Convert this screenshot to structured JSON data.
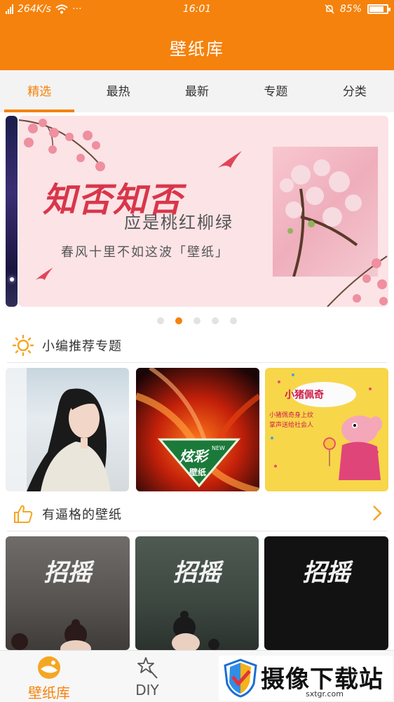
{
  "status_bar": {
    "network_speed": "264K/s",
    "more": "···",
    "time": "16:01",
    "battery": "85%",
    "battery_level": 0.85
  },
  "header": {
    "title": "壁纸库"
  },
  "tabs": [
    {
      "label": "精选",
      "active": true
    },
    {
      "label": "最热",
      "active": false
    },
    {
      "label": "最新",
      "active": false
    },
    {
      "label": "专题",
      "active": false
    },
    {
      "label": "分类",
      "active": false
    }
  ],
  "banner": {
    "title": "知否知否",
    "subtitle": "应是桃红柳绿",
    "line": "春风十里不如这波「壁纸」",
    "page_count": 5,
    "active_page": 2
  },
  "sections": {
    "recommended": {
      "label": "小编推荐专题",
      "icon": "sun-icon"
    },
    "stylish": {
      "label": "有逼格的壁纸",
      "icon": "thumbs-up-icon",
      "arrow_icon": "chevron-right-icon"
    }
  },
  "topic_cards": [
    {
      "label": ""
    },
    {
      "badge_top": "炫彩",
      "badge_new": "NEW",
      "badge_bottom": "壁纸"
    },
    {
      "title": "小猪佩奇",
      "caption_line1": "小猪佩奇身上纹",
      "caption_line2": "掌声送给社会人"
    }
  ],
  "wallpapers": [
    {
      "logo": "招摇"
    },
    {
      "logo": "招摇"
    },
    {
      "logo": "招摇"
    }
  ],
  "bottom_nav": [
    {
      "label": "壁纸库",
      "icon": "wallpaper-library-icon",
      "active": true
    },
    {
      "label": "DIY",
      "icon": "magic-star-icon",
      "active": false
    }
  ],
  "watermark": {
    "text": "摄像下载站",
    "url": "sxtgr.com"
  },
  "colors": {
    "accent": "#f5820c",
    "banner_pink": "#fbe3e6",
    "title_red": "#d9364a"
  }
}
